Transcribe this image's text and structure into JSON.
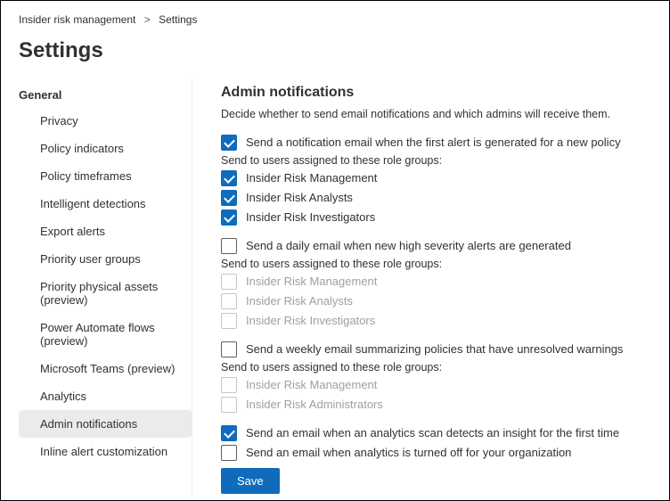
{
  "breadcrumb": {
    "parent": "Insider risk management",
    "current": "Settings"
  },
  "page_title": "Settings",
  "sidebar": {
    "heading": "General",
    "items": [
      {
        "label": "Privacy"
      },
      {
        "label": "Policy indicators"
      },
      {
        "label": "Policy timeframes"
      },
      {
        "label": "Intelligent detections"
      },
      {
        "label": "Export alerts"
      },
      {
        "label": "Priority user groups"
      },
      {
        "label": "Priority physical assets (preview)"
      },
      {
        "label": "Power Automate flows (preview)"
      },
      {
        "label": "Microsoft Teams (preview)"
      },
      {
        "label": "Analytics"
      },
      {
        "label": "Admin notifications",
        "active": true
      },
      {
        "label": "Inline alert customization"
      }
    ]
  },
  "main": {
    "heading": "Admin notifications",
    "description": "Decide whether to send email notifications and which admins will receive them.",
    "role_intro": "Send to users assigned to these role groups:",
    "block1": {
      "label": "Send a notification email when the first alert is generated for a new policy",
      "roles": [
        "Insider Risk Management",
        "Insider Risk Analysts",
        "Insider Risk Investigators"
      ]
    },
    "block2": {
      "label": "Send a daily email when new high severity alerts are generated",
      "roles": [
        "Insider Risk Management",
        "Insider Risk Analysts",
        "Insider Risk Investigators"
      ]
    },
    "block3": {
      "label": "Send a weekly email summarizing policies that have unresolved warnings",
      "roles": [
        "Insider Risk Management",
        "Insider Risk Administrators"
      ]
    },
    "opt4": "Send an email when an analytics scan detects an insight for the first time",
    "opt5": "Send an email when analytics is turned off for your organization",
    "save": "Save"
  }
}
